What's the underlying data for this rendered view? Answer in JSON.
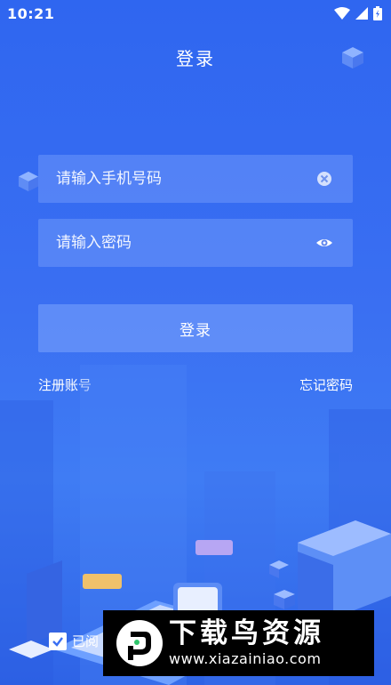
{
  "status_bar": {
    "time": "10:21",
    "icons": [
      "wifi-icon",
      "signal-icon",
      "battery-icon"
    ]
  },
  "header": {
    "title": "登录"
  },
  "form": {
    "phone": {
      "placeholder": "请输入手机号码",
      "value": "",
      "trailing_icon": "clear-icon"
    },
    "password": {
      "placeholder": "请输入密码",
      "value": "",
      "trailing_icon": "eye-icon"
    },
    "login_label": "登录"
  },
  "links": {
    "register": "注册账号",
    "forgot": "忘记密码"
  },
  "agreement": {
    "checked": true,
    "text_visible": "已阅"
  },
  "watermark": {
    "title": "下载鸟资源",
    "url": "www.xiazainiao.com"
  },
  "colors": {
    "background_top": "#2f66f0",
    "background_bottom": "#2e63e6",
    "field_fill": "rgba(140,175,255,0.35)"
  }
}
